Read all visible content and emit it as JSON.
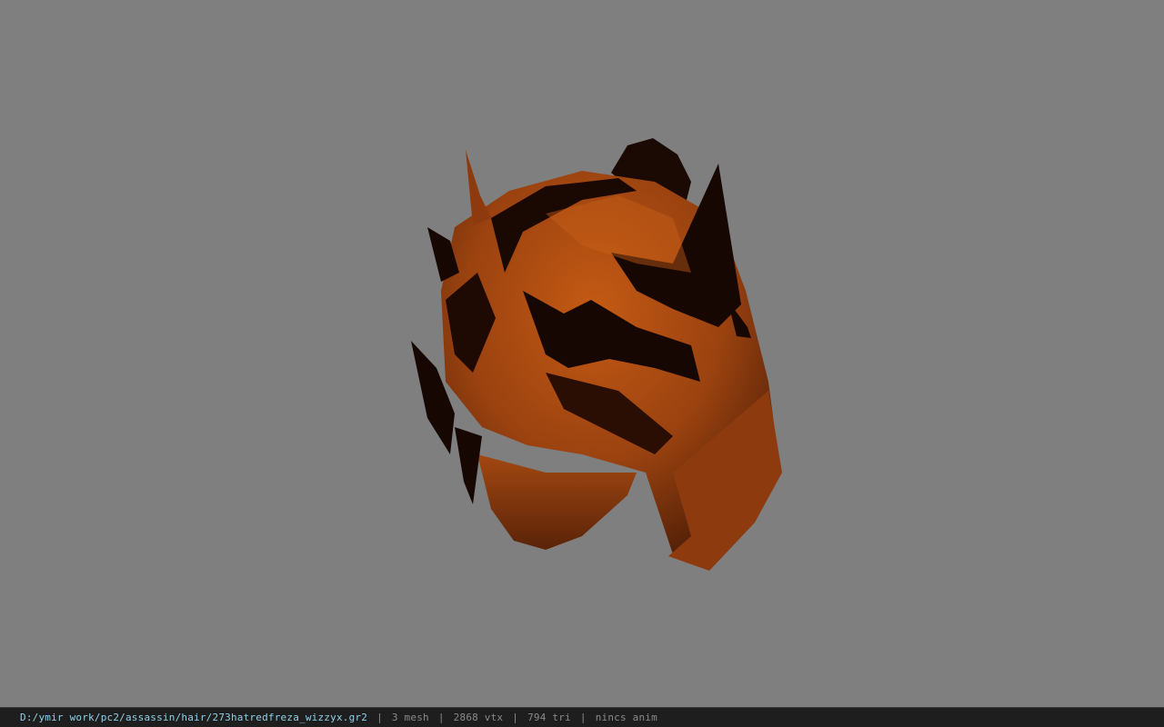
{
  "viewer": {
    "background_color": "#7f7f7f",
    "model_color": "#a8480e"
  },
  "status": {
    "file_path": "D:/ymir work/pc2/assassin/hair/273hatredfreza_wizzyx.gr2",
    "separator": "|",
    "mesh": "3 mesh",
    "vertices": "2868 vtx",
    "triangles": "794 tri",
    "anim": "nincs anim"
  }
}
